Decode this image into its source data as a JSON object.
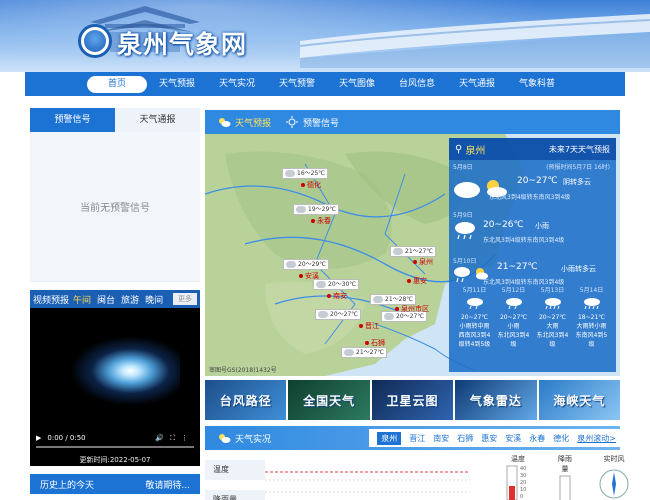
{
  "site": {
    "title": "泉州气象网"
  },
  "nav": [
    "首页",
    "天气预报",
    "天气实况",
    "天气预警",
    "天气图像",
    "台风信息",
    "天气通报",
    "气象科普"
  ],
  "left": {
    "tabs": [
      "预警信号",
      "天气通报"
    ],
    "empty": "当前无预警信号",
    "video": {
      "title": "视频预报",
      "tabs": [
        "午间",
        "闽台",
        "旅游",
        "晚间"
      ],
      "more": "更多",
      "time": "0:00 / 0:50",
      "updated": "更新时间:2022-05-07"
    },
    "history": {
      "title": "历史上的今天",
      "more": "敬请期待..."
    }
  },
  "forecast": {
    "tabs": [
      "天气预报",
      "预警信号"
    ],
    "map_caption": "审图号GS(2018)1432号",
    "map_tags": [
      {
        "t": "16～25℃"
      },
      {
        "t": "19～29℃"
      },
      {
        "t": "21～27℃"
      },
      {
        "t": "20～29℃"
      },
      {
        "t": "20～30℃"
      },
      {
        "t": "21～28℃"
      },
      {
        "t": "20～27℃"
      },
      {
        "t": "20～27℃"
      },
      {
        "t": "21～27℃"
      }
    ],
    "cities": [
      "德化",
      "永春",
      "安溪",
      "南安",
      "惠安",
      "泉州",
      "晋江",
      "石狮",
      "泉州市区"
    ],
    "card": {
      "city": "泉州",
      "title": "未来7天天气预报",
      "pub": "(预报时间5月7日 16时)",
      "days": [
        {
          "date": "5月8日",
          "temp": "20~27℃",
          "wx": "阴转多云",
          "wind": "东北风3到4级转东南风3到4级"
        },
        {
          "date": "5月9日",
          "temp": "20~26℃",
          "wx": "小雨",
          "wind": "东北风3到4级转东南风3到4级"
        },
        {
          "date": "5月10日",
          "temp": "21~27℃",
          "wx": "小雨转多云",
          "wind": "东北风3到4级转东南风3到4级"
        }
      ],
      "mini": [
        {
          "d": "5月11日",
          "t": "20~27℃",
          "wx": "小雨转中雨",
          "w": "西南风3到4级转4到5级"
        },
        {
          "d": "5月12日",
          "t": "20~27℃",
          "wx": "小雨",
          "w": "东北风3到4级"
        },
        {
          "d": "5月13日",
          "t": "20~27℃",
          "wx": "大雨",
          "w": "东北风3到4级"
        },
        {
          "d": "5月14日",
          "t": "18~21℃",
          "wx": "大雨转小雨",
          "w": "东南风4到5级"
        }
      ]
    }
  },
  "links": [
    "台风路径",
    "全国天气",
    "卫星云图",
    "气象雷达",
    "海峡天气"
  ],
  "live": {
    "title": "天气实况",
    "towns": [
      "泉州",
      "晋江",
      "南安",
      "石狮",
      "惠安",
      "安溪",
      "永春",
      "德化"
    ],
    "more": "泉州滚动>",
    "rows": [
      "温度",
      "降雨量"
    ],
    "gauges": [
      "温度",
      "降雨量",
      "实时风"
    ],
    "gauge_ticks": [
      "40",
      "30",
      "20",
      "10",
      "0"
    ]
  }
}
